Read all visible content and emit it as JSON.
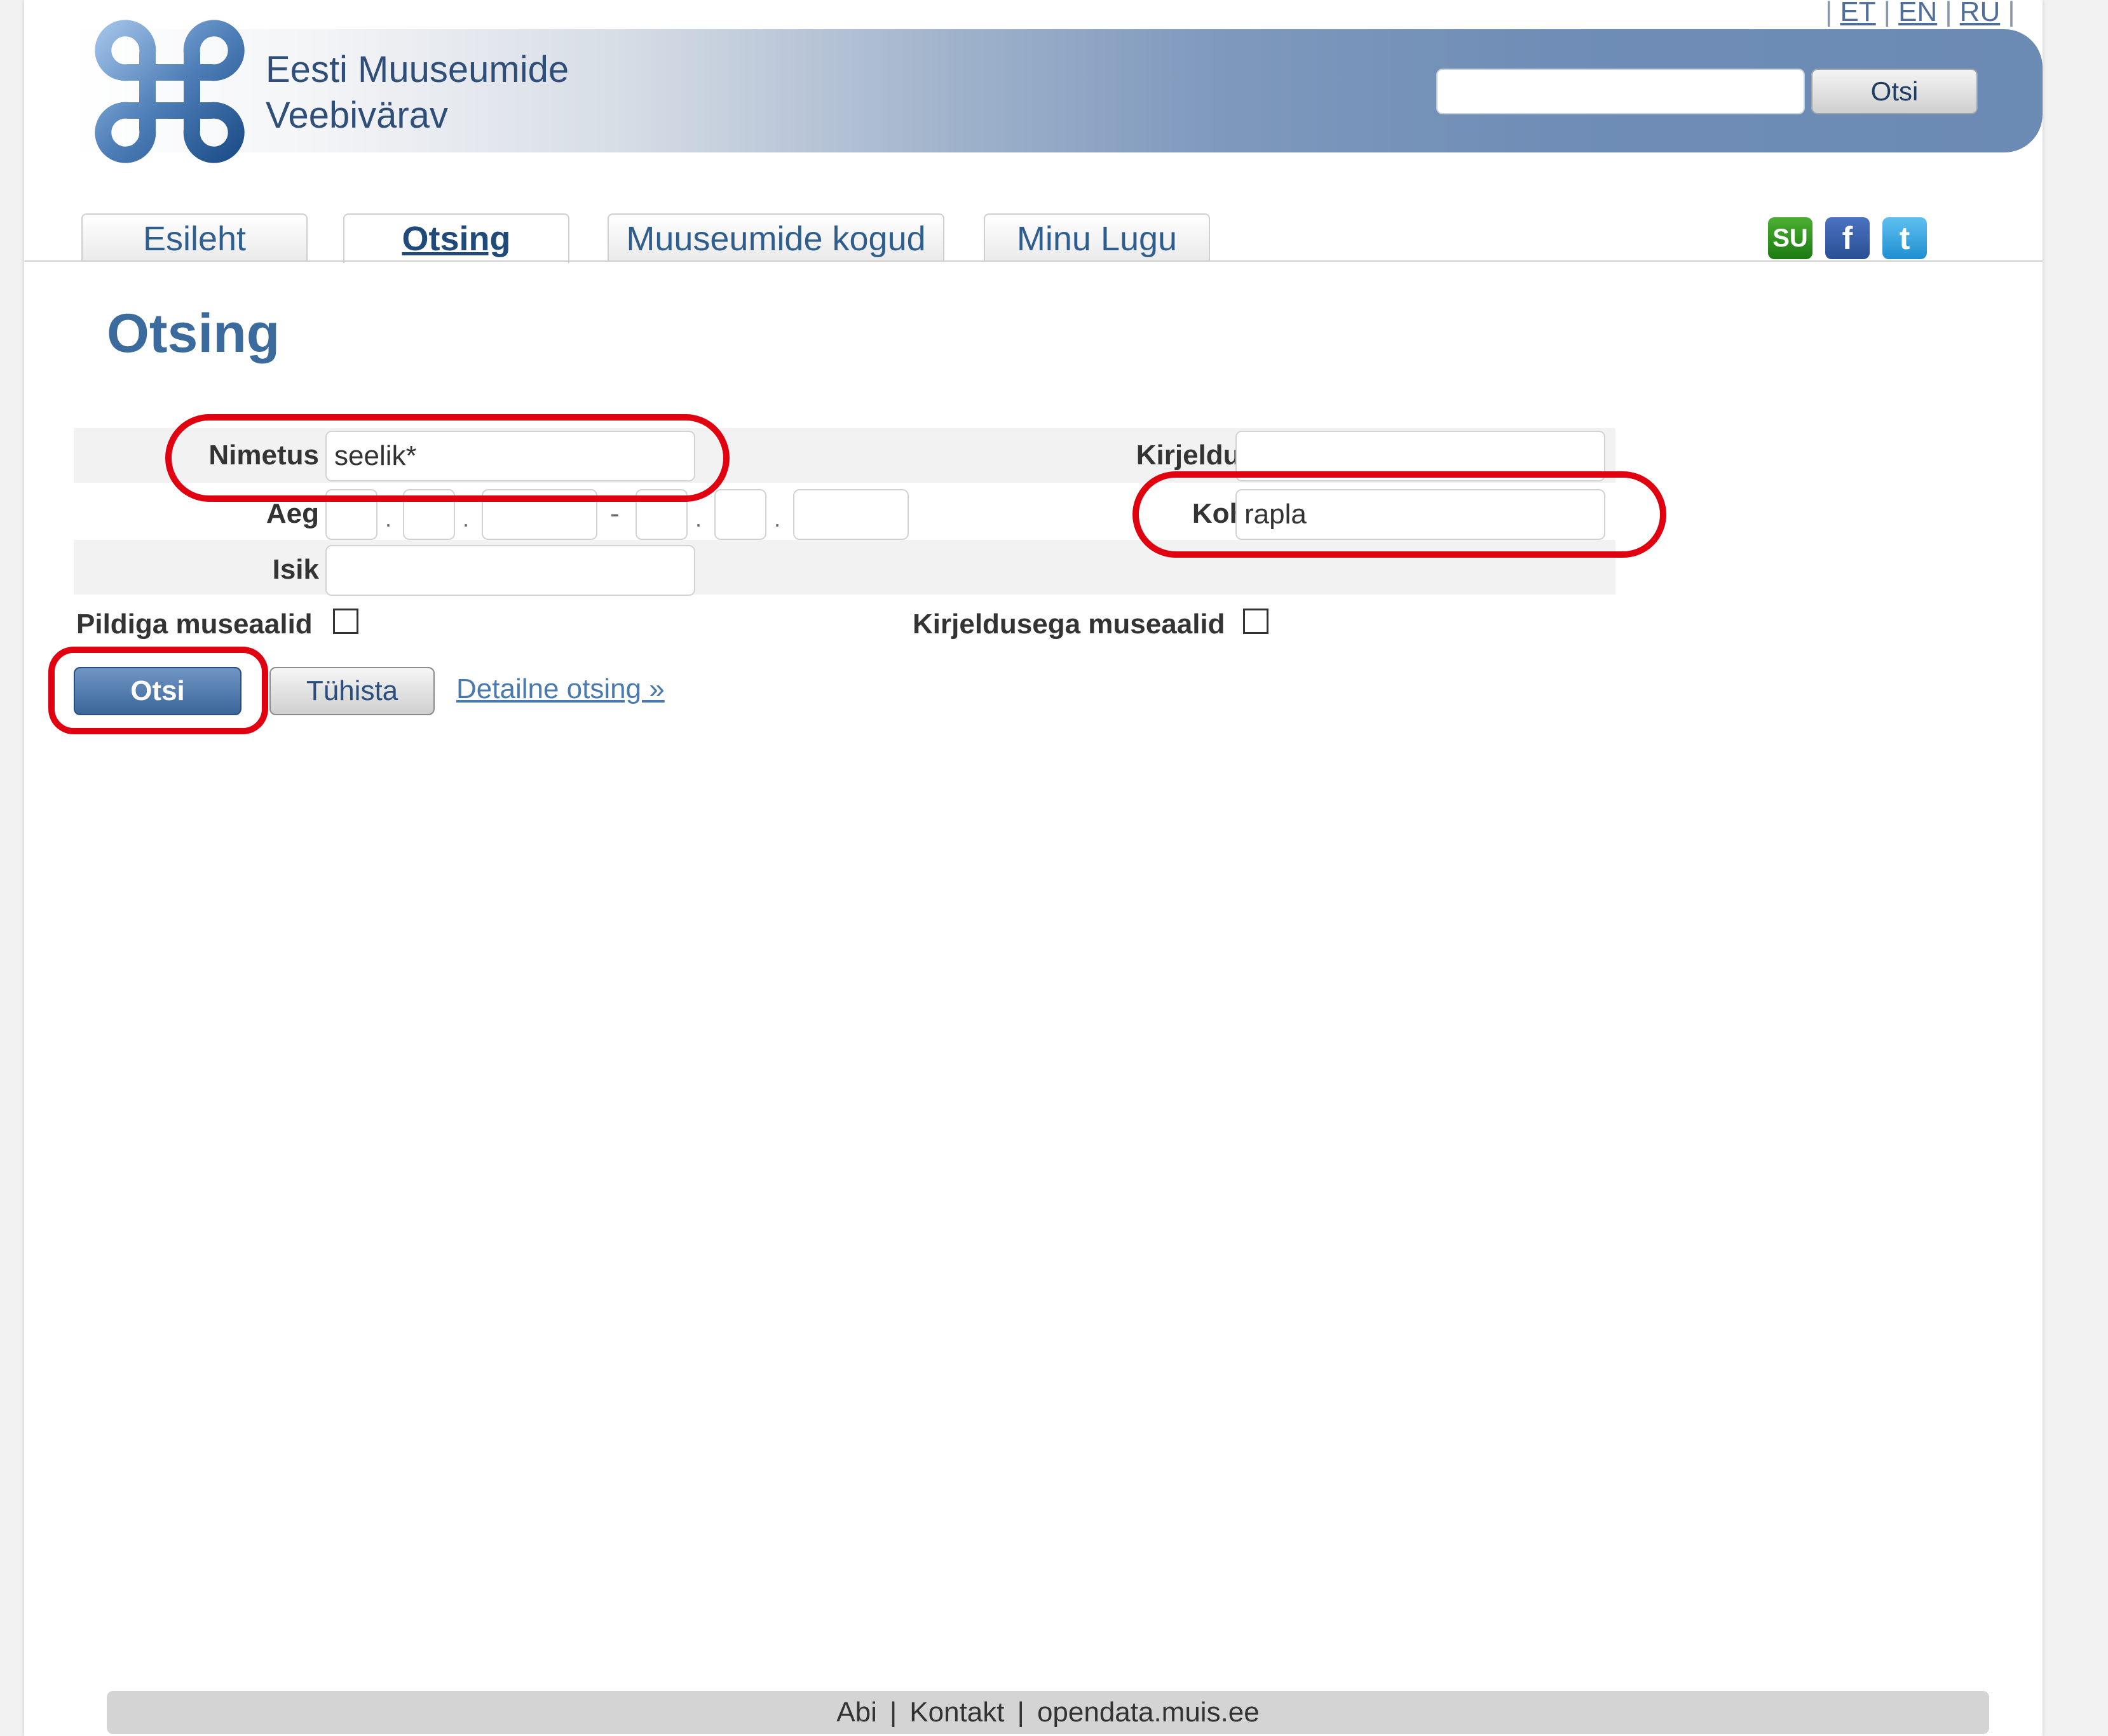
{
  "languages": [
    "ET",
    "EN",
    "RU"
  ],
  "header": {
    "title_line1": "Eesti Muuseumide",
    "title_line2": "Veebivärav",
    "search_placeholder": "",
    "search_button": "Otsi"
  },
  "tabs": [
    {
      "label": "Esileht",
      "active": false
    },
    {
      "label": "Otsing",
      "active": true
    },
    {
      "label": "Muuseumide kogud",
      "active": false
    },
    {
      "label": "Minu Lugu",
      "active": false
    }
  ],
  "social": [
    "stumbleupon-icon",
    "facebook-icon",
    "twitter-icon"
  ],
  "page_title": "Otsing",
  "form": {
    "nimetus_label": "Nimetus",
    "nimetus_value": "seelik*",
    "kirjeldus_label": "Kirjeldus",
    "kirjeldus_value": "",
    "aeg_label": "Aeg",
    "koht_label": "Koht",
    "koht_value": "rapla",
    "isik_label": "Isik",
    "isik_value": "",
    "pildiga_label": "Pildiga museaalid",
    "kirjeldusega_label": "Kirjeldusega museaalid",
    "date_separator": "-",
    "range_separator": "-"
  },
  "buttons": {
    "search": "Otsi",
    "reset": "Tühista",
    "detail_link": "Detailne otsing »"
  },
  "footer": [
    "Abi",
    "Kontakt",
    "opendata.muis.ee"
  ],
  "colors": {
    "accent": "#3c6699",
    "highlight": "#e0000f",
    "title": "#3a6b9c"
  }
}
